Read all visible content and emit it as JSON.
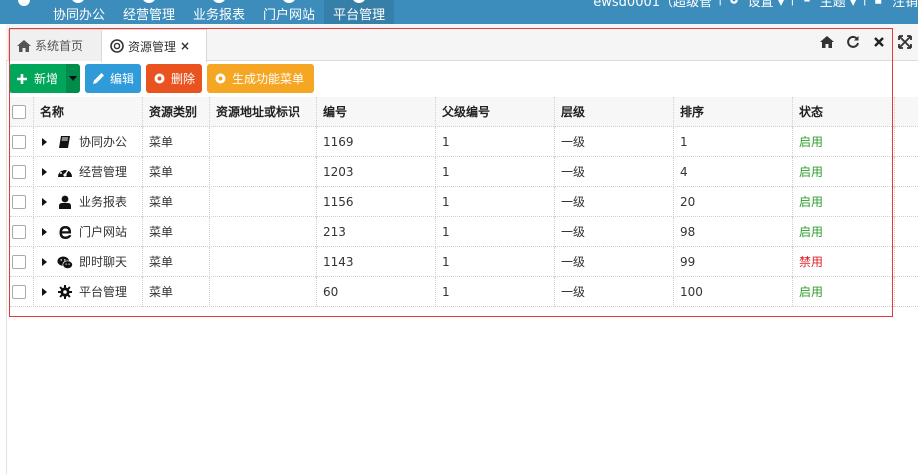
{
  "topnav": {
    "items": [
      {
        "label": "协同办公"
      },
      {
        "label": "经营管理"
      },
      {
        "label": "业务报表"
      },
      {
        "label": "门户网站"
      },
      {
        "label": "平台管理"
      }
    ],
    "user_label": "ewsd0001（超级管",
    "settings_label": "设置",
    "theme_label": "主题",
    "logout_label": "注销"
  },
  "tabs": {
    "home_label": "系统首页",
    "active_label": "资源管理",
    "close_glyph": "×"
  },
  "toolbar": {
    "add_label": "新增",
    "edit_label": "编辑",
    "delete_label": "删除",
    "generate_label": "生成功能菜单"
  },
  "grid": {
    "columns": [
      "名称",
      "资源类别",
      "资源地址或标识",
      "编号",
      "父级编号",
      "层级",
      "排序",
      "状态"
    ],
    "rows": [
      {
        "name": "协同办公",
        "icon": "book-icon",
        "type": "菜单",
        "addr": "",
        "code": "1169",
        "parent": "1",
        "level": "一级",
        "sort": "1",
        "status": "启用"
      },
      {
        "name": "经营管理",
        "icon": "dashboard-icon",
        "type": "菜单",
        "addr": "",
        "code": "1203",
        "parent": "1",
        "level": "一级",
        "sort": "4",
        "status": "启用"
      },
      {
        "name": "业务报表",
        "icon": "user-icon",
        "type": "菜单",
        "addr": "",
        "code": "1156",
        "parent": "1",
        "level": "一级",
        "sort": "20",
        "status": "启用"
      },
      {
        "name": "门户网站",
        "icon": "ie-icon",
        "type": "菜单",
        "addr": "",
        "code": "213",
        "parent": "1",
        "level": "一级",
        "sort": "98",
        "status": "启用"
      },
      {
        "name": "即时聊天",
        "icon": "wechat-icon",
        "type": "菜单",
        "addr": "",
        "code": "1143",
        "parent": "1",
        "level": "一级",
        "sort": "99",
        "status": "禁用"
      },
      {
        "name": "平台管理",
        "icon": "gear-icon",
        "type": "菜单",
        "addr": "",
        "code": "60",
        "parent": "1",
        "level": "一级",
        "sort": "100",
        "status": "启用"
      }
    ]
  },
  "colors": {
    "nav_bg": "#3c8dbc",
    "enabled": "#2e9e2e",
    "disabled": "#e0242b",
    "outline": "#e23a3a"
  }
}
